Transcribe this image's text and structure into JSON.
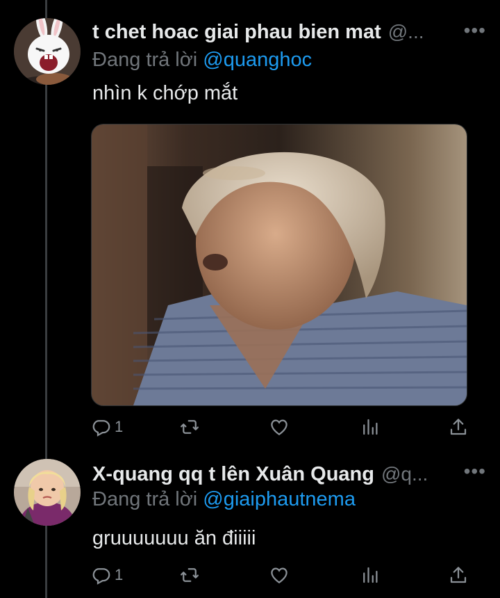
{
  "tweets": [
    {
      "display_name": "t chet hoac giai phau bien mat",
      "handle": "@...",
      "more": "•••",
      "replying_prefix": "Đang trả lời",
      "replying_to": "@quanghoc",
      "text": "nhìn k chớp mắt",
      "reply_count": "1",
      "avatar_icon": "white-rabbit-avatar",
      "media_description": "video-frame"
    },
    {
      "display_name": "X-quang qq t lên Xuân Quang",
      "handle": "@q...",
      "more": "•••",
      "replying_prefix": "Đang trả lời",
      "replying_to": "@giaiphautnema",
      "text": "gruuuuuuu ăn điiiii",
      "reply_count": "1",
      "avatar_icon": "child-photo-avatar"
    }
  ],
  "colors": {
    "background": "#000000",
    "text": "#e7e9ea",
    "secondary": "#71767b",
    "link": "#1d9bf0",
    "thread_line": "#3a3d40"
  }
}
